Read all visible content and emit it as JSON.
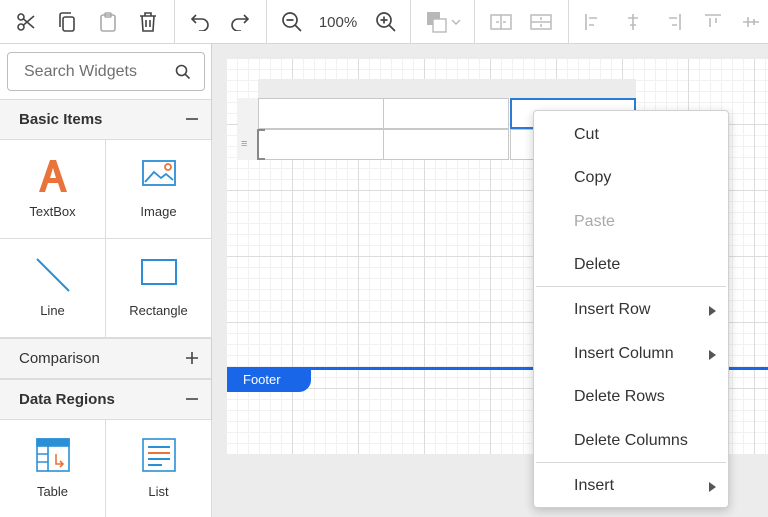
{
  "toolbar": {
    "zoom_level": "100%"
  },
  "sidebar": {
    "search_placeholder": "Search Widgets",
    "sections": {
      "basic": {
        "title": "Basic Items"
      },
      "comparison": {
        "title": "Comparison"
      },
      "data_regions": {
        "title": "Data Regions"
      }
    },
    "basic_items": [
      {
        "label": "TextBox",
        "icon": "textbox-icon"
      },
      {
        "label": "Image",
        "icon": "image-icon"
      },
      {
        "label": "Line",
        "icon": "line-icon"
      },
      {
        "label": "Rectangle",
        "icon": "rectangle-icon"
      }
    ],
    "data_region_items": [
      {
        "label": "Table",
        "icon": "table-icon"
      },
      {
        "label": "List",
        "icon": "list-icon"
      }
    ]
  },
  "canvas": {
    "footer_label": "Footer"
  },
  "context_menu": {
    "items": [
      {
        "label": "Cut",
        "enabled": true,
        "submenu": false
      },
      {
        "label": "Copy",
        "enabled": true,
        "submenu": false
      },
      {
        "label": "Paste",
        "enabled": false,
        "submenu": false
      },
      {
        "label": "Delete",
        "enabled": true,
        "submenu": false
      },
      {
        "label": "Insert Row",
        "enabled": true,
        "submenu": true
      },
      {
        "label": "Insert Column",
        "enabled": true,
        "submenu": true
      },
      {
        "label": "Delete Rows",
        "enabled": true,
        "submenu": false
      },
      {
        "label": "Delete Columns",
        "enabled": true,
        "submenu": false
      },
      {
        "label": "Insert",
        "enabled": true,
        "submenu": true
      }
    ]
  },
  "colors": {
    "accent": "#1a66e8",
    "selection": "#2a7bd6",
    "textbox_icon": "#e8743b",
    "image_icon": "#2b8fd6"
  }
}
